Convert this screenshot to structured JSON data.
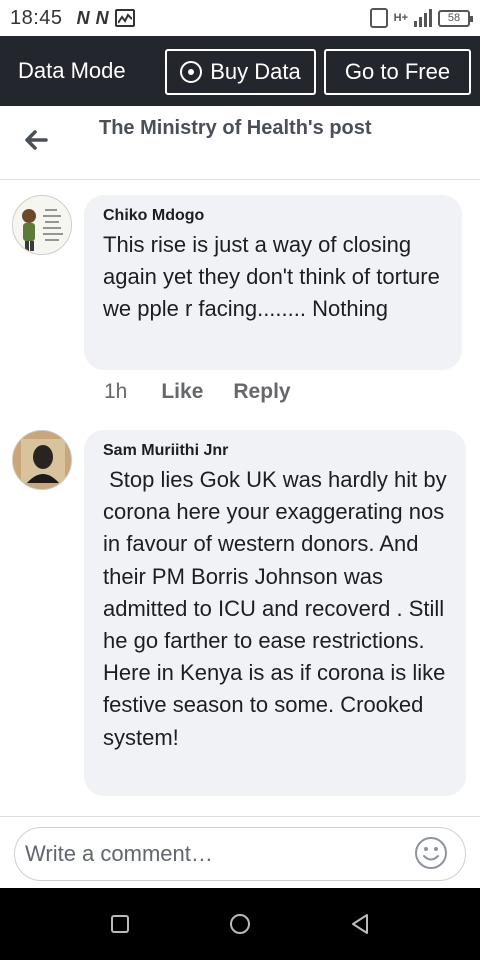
{
  "status_bar": {
    "time": "18:45",
    "notification_icons": [
      "n-icon",
      "n-icon",
      "activity-icon"
    ],
    "network_label": "H+",
    "battery_level": "58"
  },
  "data_mode_bar": {
    "title": "Data Mode",
    "buy_button_label": "Buy Data",
    "free_button_label": "Go to Free"
  },
  "header": {
    "title": "The Ministry of Health's post"
  },
  "comments": [
    {
      "author": "Chiko Mdogo",
      "text": "This rise is just a way of closing again yet they don't think of torture we pple r facing........ Nothing",
      "time": "1h",
      "like_label": "Like",
      "reply_label": "Reply"
    },
    {
      "author": "Sam Muriithi Jnr",
      "text": " Stop lies Gok UK was hardly hit by corona here your exaggerating nos in favour of western donors. And their PM Borris Johnson was admitted to ICU and recoverd . Still he go farther to ease restrictions. Here in Kenya is as if corona is like festive season to some. Crooked system!"
    }
  ],
  "composer": {
    "placeholder": "Write a comment…"
  },
  "colors": {
    "data_bar_bg": "#23272d",
    "bubble_bg": "#f0f2f5",
    "nav_bg": "#000000"
  }
}
